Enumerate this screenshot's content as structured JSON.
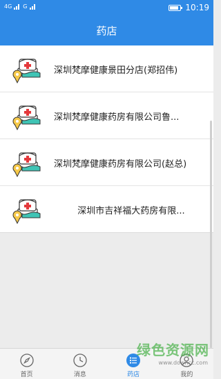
{
  "status": {
    "left_text_1": "4G",
    "left_text_2": "G",
    "time": "10:19",
    "battery_level": 0.85
  },
  "header": {
    "title": "药店"
  },
  "stores": [
    {
      "name": "深圳梵摩健康景田分店(郑招伟)"
    },
    {
      "name": "深圳梵摩健康药房有限公司鲁..."
    },
    {
      "name": "深圳梵摩健康药房有限公司(赵总)"
    },
    {
      "name": "深圳市吉祥福大药房有限..."
    }
  ],
  "tabs": [
    {
      "label": "首页",
      "icon": "compass-icon"
    },
    {
      "label": "消息",
      "icon": "clock-icon"
    },
    {
      "label": "药店",
      "icon": "list-icon"
    },
    {
      "label": "我的",
      "icon": "user-icon"
    }
  ],
  "active_tab": 2,
  "watermark": {
    "text": "绿色资源网",
    "url": "www.downcc.com"
  },
  "colors": {
    "primary": "#2f8ae6",
    "background": "#ececec",
    "icon_teal": "#3fc4b5",
    "icon_red": "#e4393c"
  }
}
